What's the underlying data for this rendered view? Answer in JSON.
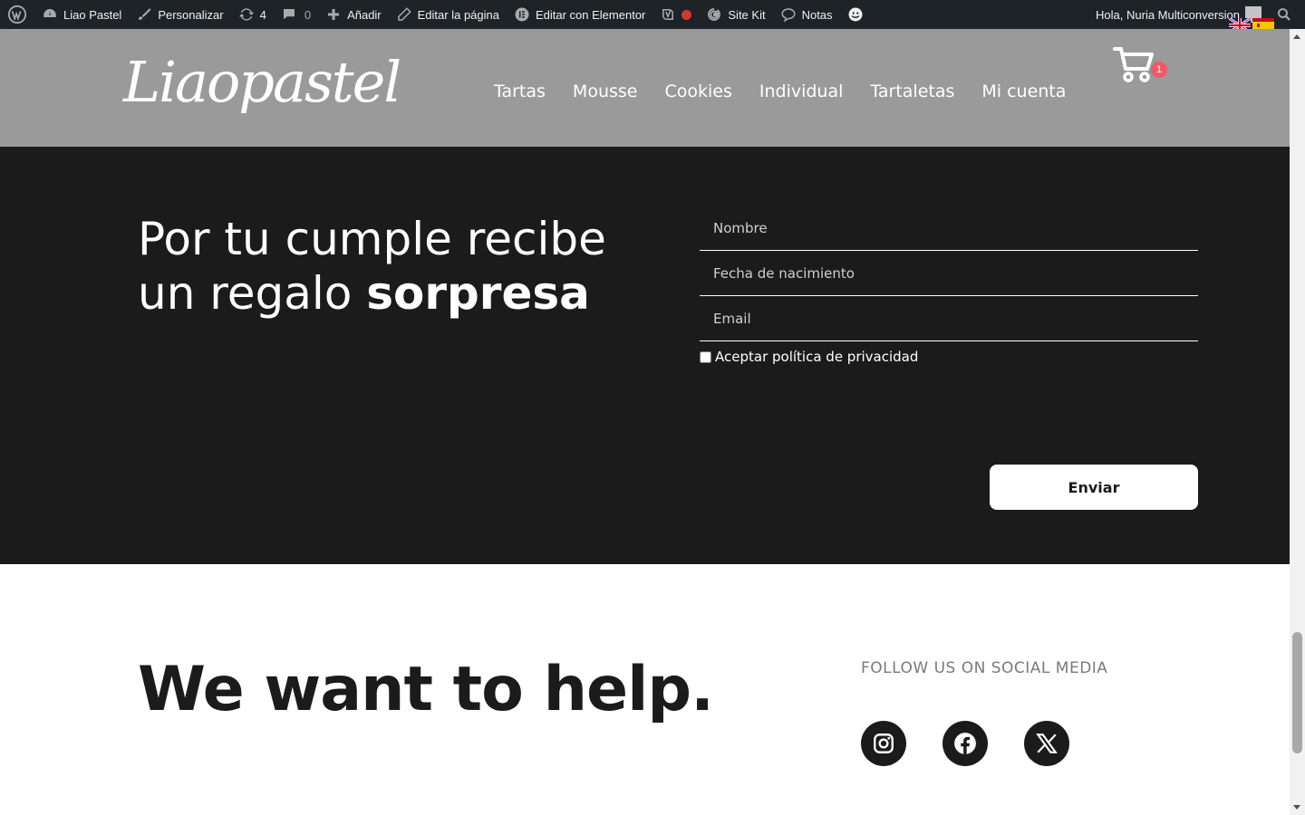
{
  "adminbar": {
    "site_name": "Liao Pastel",
    "customize": "Personalizar",
    "updates_count": "4",
    "comments_count": "0",
    "add_new": "Añadir",
    "edit_page": "Editar la página",
    "edit_elementor": "Editar con Elementor",
    "site_kit": "Site Kit",
    "notes": "Notas",
    "greeting": "Hola, Nuria Multiconversion"
  },
  "header": {
    "logo": "Liaopastel",
    "nav": [
      "Tartas",
      "Mousse",
      "Cookies",
      "Individual",
      "Tartaletas",
      "Mi cuenta"
    ],
    "cart_count": "1"
  },
  "promo": {
    "headline_line1": "Por tu cumple recibe",
    "headline_line2_regular": "un regalo ",
    "headline_line2_bold": "sorpresa",
    "form": {
      "name_placeholder": "Nombre",
      "birthdate_placeholder": "Fecha de nacimiento",
      "email_placeholder": "Email",
      "privacy_label": "Aceptar política de privacidad",
      "submit_label": "Enviar"
    }
  },
  "footer": {
    "headline": "We want to help.",
    "social_title": "FOLLOW US ON SOCIAL MEDIA",
    "social_icons": [
      "instagram-icon",
      "facebook-icon",
      "x-icon"
    ]
  },
  "colors": {
    "adminbar_bg": "#1d2327",
    "header_bg": "#9a9a9a",
    "dark_bg": "#1b1b1b",
    "badge": "#ef5a68",
    "recording_dot": "#d63638"
  }
}
